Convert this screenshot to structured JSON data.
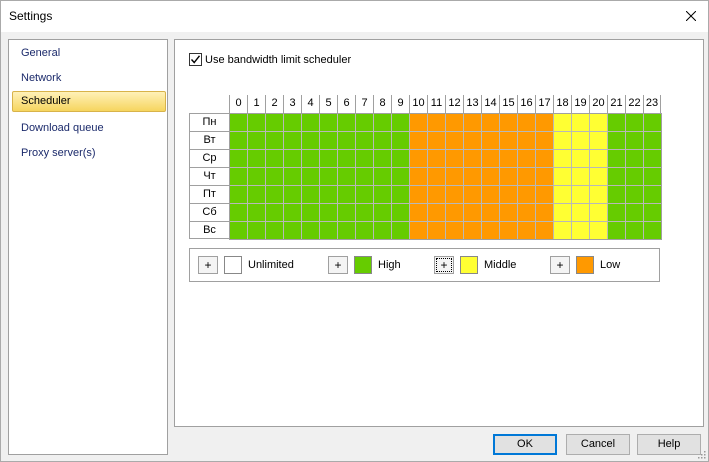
{
  "window": {
    "title": "Settings"
  },
  "nav": {
    "items": [
      {
        "label": "General",
        "selected": false
      },
      {
        "label": "Network",
        "selected": false
      },
      {
        "label": "Scheduler",
        "selected": true
      },
      {
        "label": "Download queue",
        "selected": false
      },
      {
        "label": "Proxy server(s)",
        "selected": false
      }
    ]
  },
  "scheduler": {
    "enable_label": "Use bandwidth limit scheduler",
    "enabled": true,
    "hours": [
      "0",
      "1",
      "2",
      "3",
      "4",
      "5",
      "6",
      "7",
      "8",
      "9",
      "10",
      "11",
      "12",
      "13",
      "14",
      "15",
      "16",
      "17",
      "18",
      "19",
      "20",
      "21",
      "22",
      "23"
    ],
    "days": [
      "Пн",
      "Вт",
      "Ср",
      "Чт",
      "Пт",
      "Сб",
      "Вс"
    ],
    "hour_levels": [
      "high",
      "high",
      "high",
      "high",
      "high",
      "high",
      "high",
      "high",
      "high",
      "high",
      "low",
      "low",
      "low",
      "low",
      "low",
      "low",
      "low",
      "low",
      "middle",
      "middle",
      "middle",
      "high",
      "high",
      "high"
    ],
    "level_colors": {
      "unlimited": "#ffffff",
      "high": "#66cc00",
      "middle": "#ffff33",
      "low": "#ff9900"
    }
  },
  "legend": {
    "plus_label": "+",
    "items": [
      {
        "key": "unlimited",
        "label": "Unlimited"
      },
      {
        "key": "high",
        "label": "High"
      },
      {
        "key": "middle",
        "label": "Middle"
      },
      {
        "key": "low",
        "label": "Low"
      }
    ]
  },
  "buttons": {
    "ok": "OK",
    "cancel": "Cancel",
    "help": "Help"
  }
}
